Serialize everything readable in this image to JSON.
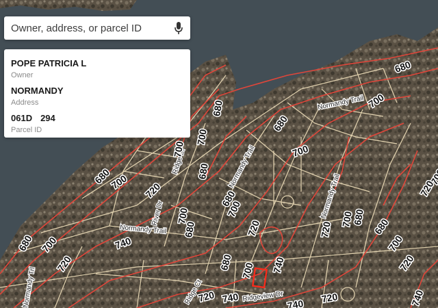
{
  "search": {
    "placeholder": "Owner, address, or parcel ID",
    "mic_icon": "microphone-icon"
  },
  "parcel_card": {
    "owner_value": "POPE PATRICIA L",
    "owner_label": "Owner",
    "address_value": "NORMANDY",
    "address_label": "Address",
    "parcel_id_part1": "061D",
    "parcel_id_part2": "294",
    "parcel_id_label": "Parcel ID"
  },
  "map": {
    "contour_labels": [
      "680",
      "700",
      "700",
      "680",
      "700",
      "680",
      "700",
      "720",
      "680",
      "700",
      "700",
      "720",
      "680",
      "700",
      "720",
      "680",
      "700",
      "680",
      "680",
      "680",
      "700",
      "720",
      "740",
      "700",
      "720",
      "740",
      "720",
      "740",
      "680",
      "700",
      "720",
      "740",
      "720",
      "740",
      "680",
      "700"
    ],
    "street_labels": [
      "Normandy Trail",
      "Normandy Trail",
      "Normandy Trail",
      "Normandy Trail",
      "Ridge Dr",
      "River Dr",
      "Normandy Trl",
      "Ridgeview Dr",
      "Ridge Ct"
    ],
    "colors": {
      "water": "#434e55",
      "land": "#5d5648",
      "parcel_line": "#f3e3bd",
      "contour_line": "#e0463a",
      "selected_parcel": "#ff2a1a"
    }
  }
}
